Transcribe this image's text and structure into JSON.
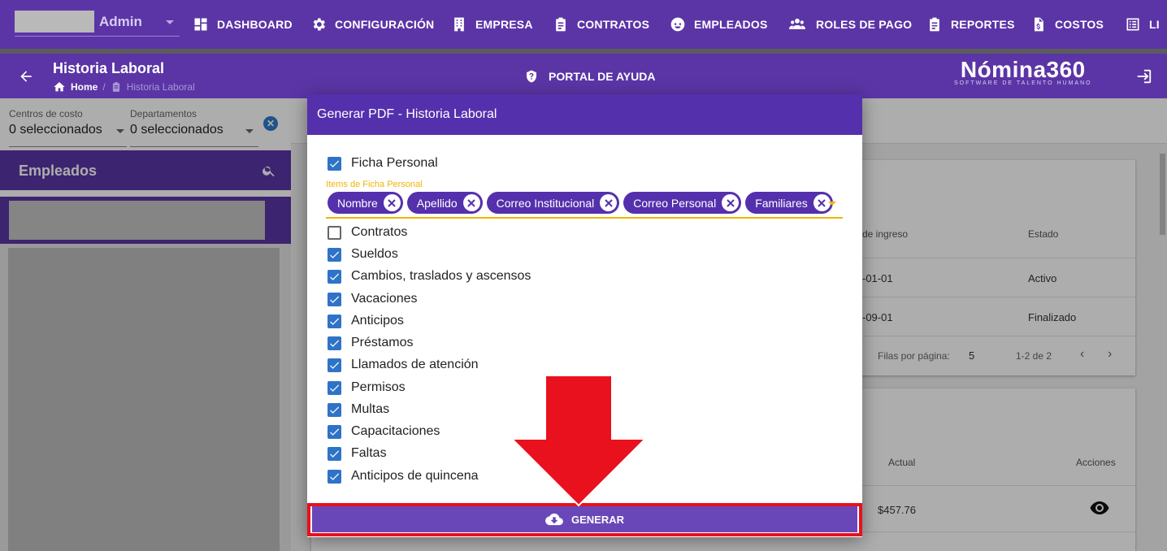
{
  "nav": {
    "role": "Admin",
    "items": [
      {
        "label": "DASHBOARD",
        "icon": "dashboard-icon"
      },
      {
        "label": "CONFIGURACIÓN",
        "icon": "gear-icon"
      },
      {
        "label": "EMPRESA",
        "icon": "building-icon"
      },
      {
        "label": "CONTRATOS",
        "icon": "clipboard-icon"
      },
      {
        "label": "EMPLEADOS",
        "icon": "face-icon"
      },
      {
        "label": "ROLES DE PAGO",
        "icon": "group-icon"
      },
      {
        "label": "REPORTES",
        "icon": "clipboard-icon"
      },
      {
        "label": "COSTOS",
        "icon": "file-dollar-icon"
      },
      {
        "label": "LI",
        "icon": "list-icon"
      }
    ]
  },
  "header": {
    "title": "Historia Laboral",
    "breadcrumb_home": "Home",
    "breadcrumb_sep": "/",
    "breadcrumb_current": "Historia Laboral",
    "help_label": "PORTAL DE AYUDA",
    "logo_main": "Nómina360",
    "logo_sub": "SOFTWARE DE TALENTO HUMANO"
  },
  "filters": {
    "cost_centers_label": "Centros de costo",
    "cost_centers_value": "0 seleccionados",
    "departments_label": "Departamentos",
    "departments_value": "0 seleccionados"
  },
  "sidebar": {
    "employees_title": "Empleados"
  },
  "background_table": {
    "headers": [
      "de ingreso",
      "Estado"
    ],
    "rows": [
      {
        "date": "-01-01",
        "status": "Activo"
      },
      {
        "date": "-09-01",
        "status": "Finalizado"
      }
    ],
    "rows_per_page_label": "Filas por página:",
    "rows_per_page": "5",
    "range": "1-2 de 2",
    "second_headers": [
      "Actual",
      "Acciones"
    ],
    "second_value": "$457.76"
  },
  "dialog": {
    "title": "Generar PDF - Historia Laboral",
    "ficha_label": "Ficha Personal",
    "chips_label": "Items de Ficha Personal",
    "chips": [
      "Nombre",
      "Apellido",
      "Correo Institucional",
      "Correo Personal",
      "Familiares"
    ],
    "options": [
      {
        "label": "Contratos",
        "checked": false
      },
      {
        "label": "Sueldos",
        "checked": true
      },
      {
        "label": "Cambios, traslados y ascensos",
        "checked": true
      },
      {
        "label": "Vacaciones",
        "checked": true
      },
      {
        "label": "Anticipos",
        "checked": true
      },
      {
        "label": "Préstamos",
        "checked": true
      },
      {
        "label": "Llamados de atención",
        "checked": true
      },
      {
        "label": "Permisos",
        "checked": true
      },
      {
        "label": "Multas",
        "checked": true
      },
      {
        "label": "Capacitaciones",
        "checked": true
      },
      {
        "label": "Faltas",
        "checked": true
      },
      {
        "label": "Anticipos de quincena",
        "checked": true
      }
    ],
    "generate_label": "GENERAR"
  },
  "colors": {
    "primary": "#5b35a6",
    "dialog_header": "#5530ad",
    "checkbox": "#2f73c7",
    "accent_yellow": "#f1b400",
    "highlight_red": "#e8111d"
  }
}
